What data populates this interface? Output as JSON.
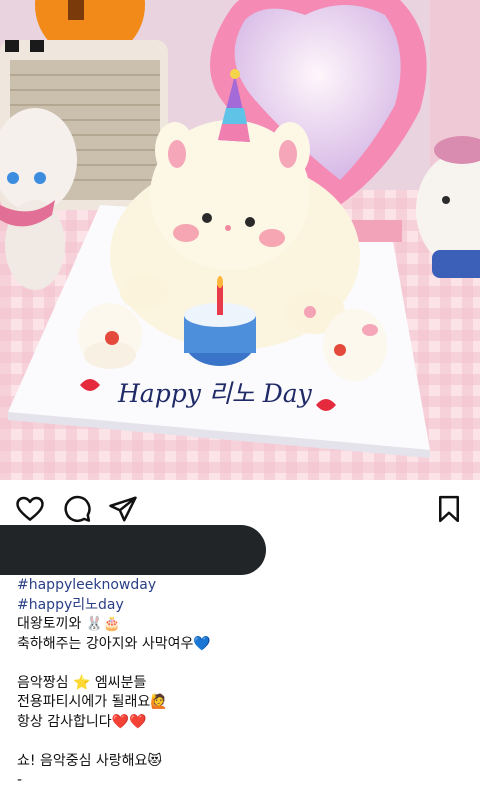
{
  "post": {
    "caption": {
      "hashtags": [
        "#happyleeknowday",
        "#happy리노day"
      ],
      "lines": [
        "대왕토끼와 🐰🎂",
        "축하해주는 강아지와 사막여우💙",
        "",
        "음악짱심 ⭐ 엠씨분들",
        "전용파티시에가 될래요🙋",
        "항상 감사합니다❤️❤️",
        "",
        "쇼! 음악중심 사랑해요😻",
        "-"
      ]
    },
    "photo": {
      "cake_text": "Happy 리노 Day",
      "description_icons": [
        "heart-icon",
        "party-hat",
        "candle"
      ]
    }
  },
  "actions": {
    "like_icon": "heart-outline-icon",
    "comment_icon": "comment-bubble-icon",
    "share_icon": "send-paper-plane-icon",
    "save_icon": "bookmark-icon"
  },
  "colors": {
    "hashtag": "#2a3f86",
    "text": "#111111",
    "redaction": "#222528"
  }
}
